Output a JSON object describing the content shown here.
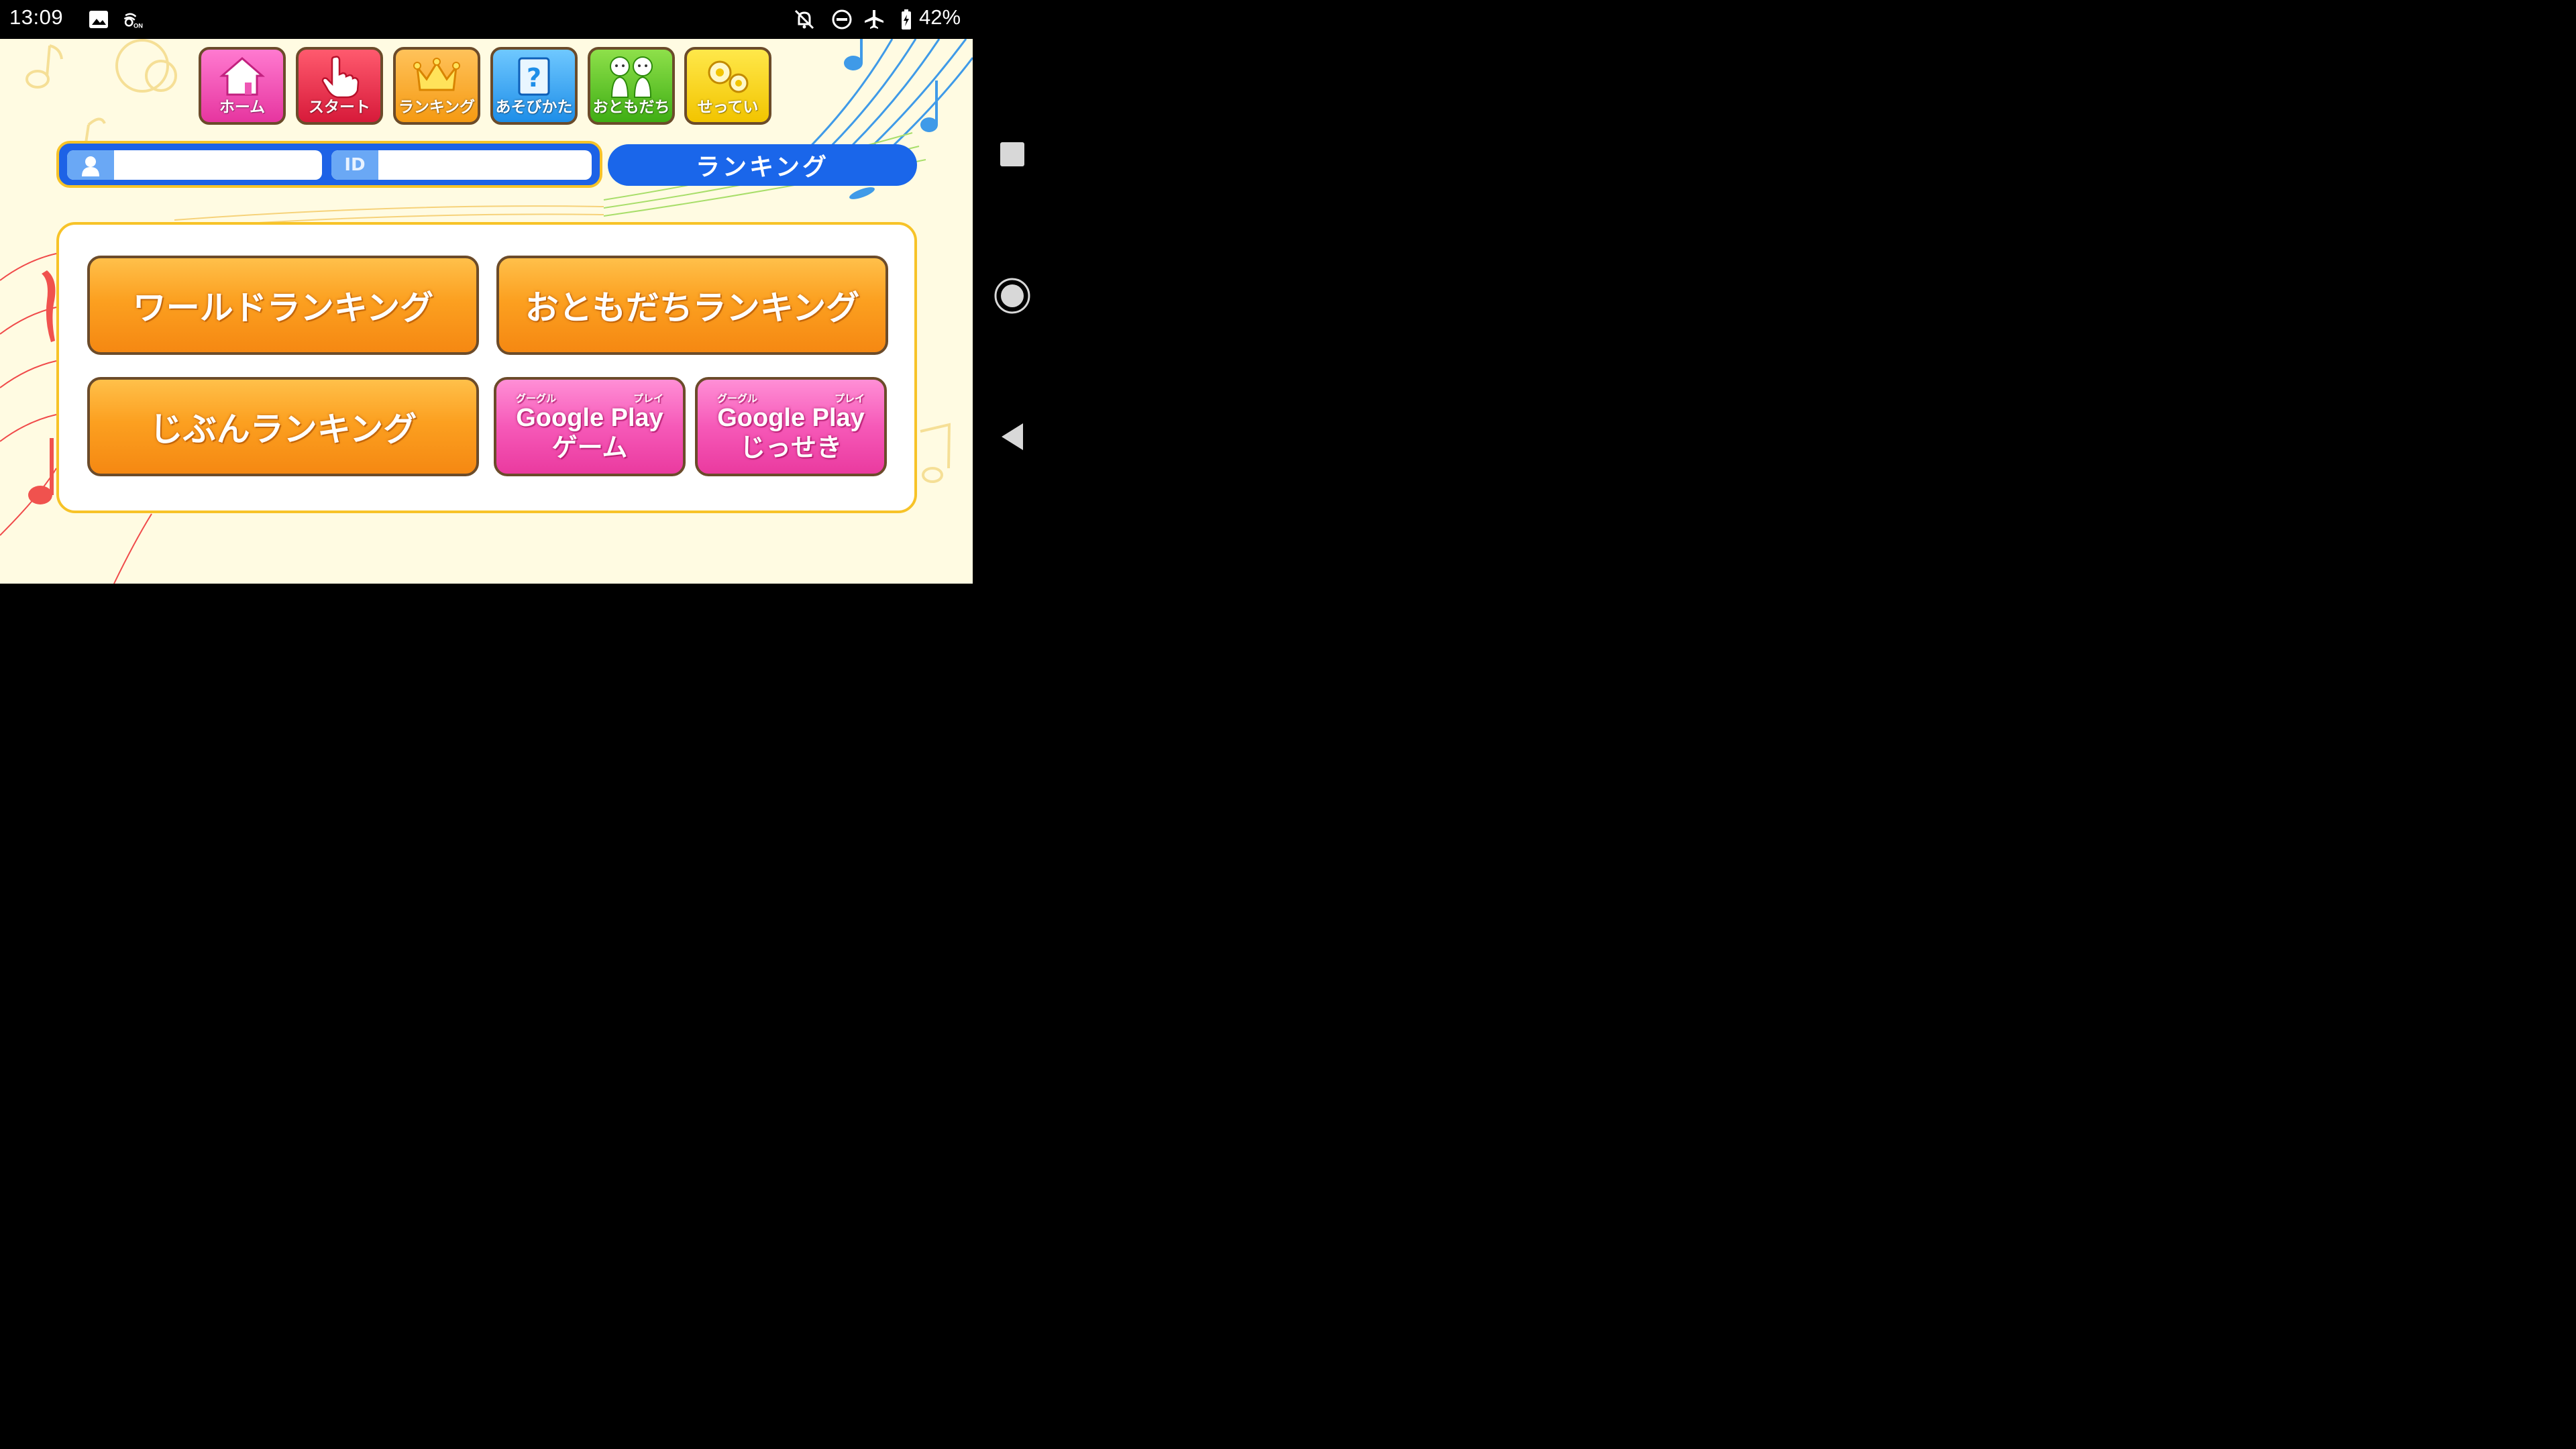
{
  "status_bar": {
    "time": "13:09",
    "battery": "42%",
    "icons": [
      "image-icon",
      "nfc-on-icon",
      "notifications-off-icon",
      "do-not-disturb-icon",
      "airplane-icon",
      "battery-charging-icon"
    ],
    "nfc_badge": "ON"
  },
  "toolbar": {
    "home": "ホーム",
    "start": "スタート",
    "ranking": "ランキング",
    "how_to_play": "あそびかた",
    "friends": "おともだち",
    "settings": "せってい"
  },
  "user": {
    "name_value": "",
    "id_tag": "ID",
    "id_value": ""
  },
  "header": {
    "title": "ランキング"
  },
  "buttons": {
    "world_ranking": "ワールドランキング",
    "friends_ranking": "おともだちランキング",
    "my_ranking": "じぶんランキング",
    "gp_games": {
      "ruby_left": "グーグル",
      "ruby_right": "プレイ",
      "line1": "Google Play",
      "line2": "ゲーム"
    },
    "gp_achievements": {
      "ruby_left": "グーグル",
      "ruby_right": "プレイ",
      "line1": "Google Play",
      "line2": "じっせき"
    }
  },
  "colors": {
    "background": "#fffbe2",
    "orange_button": "#fca020",
    "pink_button": "#f659b8",
    "blue_header": "#1a66ea",
    "panel_border": "#f7c328"
  }
}
